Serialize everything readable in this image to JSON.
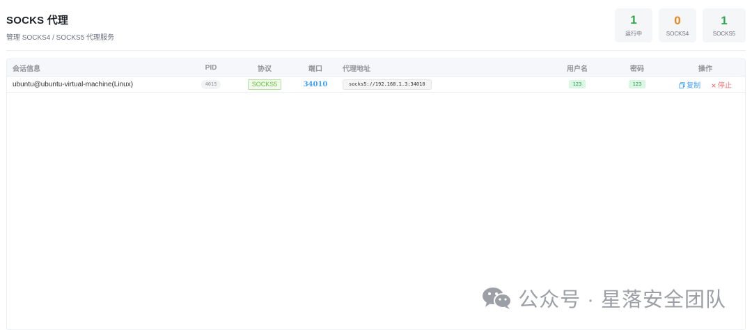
{
  "header": {
    "title": "SOCKS 代理",
    "subtitle": "管理 SOCKS4 / SOCKS5 代理服务"
  },
  "stats": [
    {
      "value": "1",
      "label": "运行中",
      "color": "#2ea84a"
    },
    {
      "value": "0",
      "label": "SOCKS4",
      "color": "#e6861f"
    },
    {
      "value": "1",
      "label": "SOCKS5",
      "color": "#2ea84a"
    }
  ],
  "table": {
    "columns": {
      "info": "会话信息",
      "pid": "PID",
      "protocol": "协议",
      "port": "端口",
      "address": "代理地址",
      "username": "用户名",
      "password": "密码",
      "actions": "操作"
    },
    "rows": [
      {
        "info": "ubuntu@ubuntu-virtual-machine(Linux)",
        "pid": "4015",
        "protocol": "SOCKS5",
        "port": "34010",
        "address": "socks5://192.168.1.3:34010",
        "username": "123",
        "password": "123",
        "copy_label": "复制",
        "stop_label": "停止"
      }
    ]
  },
  "watermark": {
    "text": "公众号 · 星落安全团队",
    "icon": "wechat-icon"
  }
}
